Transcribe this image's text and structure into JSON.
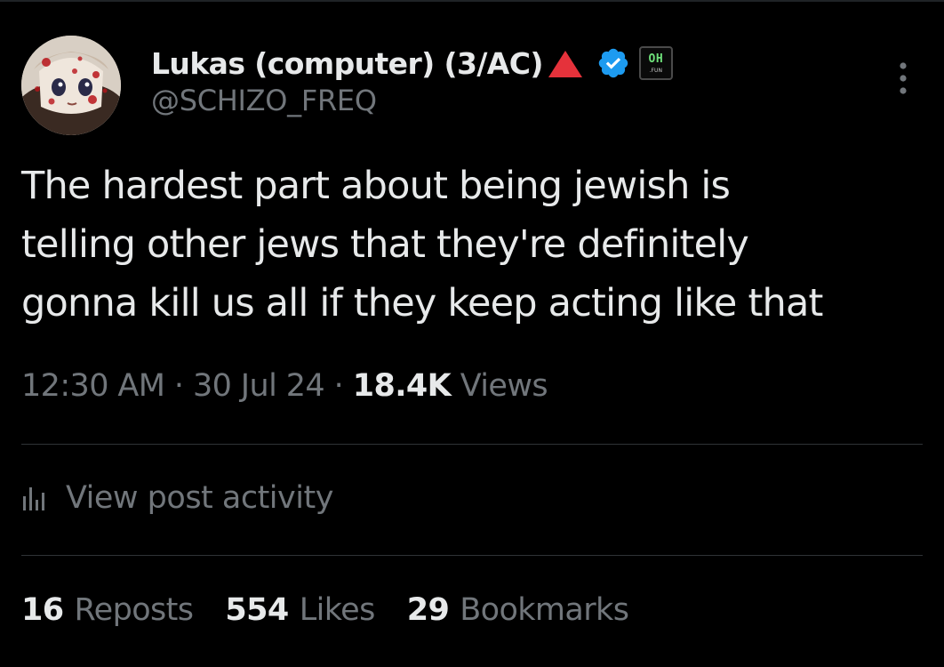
{
  "post": {
    "author": {
      "display_name": "Lukas (computer) (3/AC)",
      "handle": "@SCHIZO_FREQ",
      "avatar": "anime-character-avatar",
      "name_emoji": "red-triangle-icon",
      "verified": "verified-badge-icon",
      "affiliation_badge": {
        "top_text": "OH",
        "bottom_text": ".FUN"
      }
    },
    "text_lines": [
      "The hardest part about being jewish is",
      "telling other jews that they're definitely",
      "gonna kill us all if they keep acting like that"
    ],
    "meta": {
      "time": "12:30 AM",
      "separator": "·",
      "date": "30 Jul 24",
      "views_count": "18.4K",
      "views_label": "Views"
    },
    "activity": {
      "icon": "bar-chart-icon",
      "label": "View post activity"
    },
    "stats": [
      {
        "count": "16",
        "label": "Reposts"
      },
      {
        "count": "554",
        "label": "Likes"
      },
      {
        "count": "29",
        "label": "Bookmarks"
      }
    ]
  },
  "colors": {
    "background": "#000000",
    "primary_text": "#e7e9ea",
    "secondary_text": "#71767b",
    "divider": "#2f3336",
    "verified_blue": "#1d9bf0",
    "triangle_red": "#e5323b"
  }
}
